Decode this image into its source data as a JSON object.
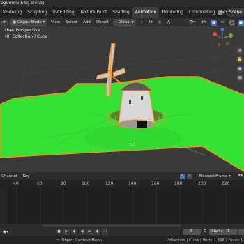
{
  "window": {
    "title": "eğirmeni\\bitiş.blend]"
  },
  "workspace_tabs": [
    "Modeling",
    "Sculpting",
    "UV Editing",
    "Texture Paint",
    "Shading",
    "Animation",
    "Rendering",
    "Compositing",
    "Scripting"
  ],
  "scene_label": "Scene",
  "viewport_header": {
    "mode": "Object Mode",
    "menus": [
      "View",
      "Select",
      "Add",
      "Object"
    ],
    "transform_orientation": "Global"
  },
  "viewport": {
    "perspective": "User Perspective",
    "collection_info": "(8) Collection | Cube"
  },
  "timeline_header": {
    "menus": [
      "Channel",
      "Key"
    ],
    "snap_mode": "Nearest Frame"
  },
  "timeline_ruler": {
    "ticks": [
      "40",
      "60",
      "80",
      "100",
      "120",
      "140",
      "160",
      "180",
      "200",
      "220"
    ]
  },
  "playback": {
    "current_frame": "8",
    "start_label": "Start:",
    "start_value": "1"
  },
  "status_bar": {
    "hint": "Object Context Menu",
    "stats": "Collection | Cube | Verts:1,696 | Faces:1,"
  },
  "colors": {
    "ground": "#36e636",
    "ground_dark": "#29c32a",
    "selection_outline": "#ff8c1a",
    "accent_blue": "#4772b3",
    "timeline_playhead": "#4772b3"
  }
}
